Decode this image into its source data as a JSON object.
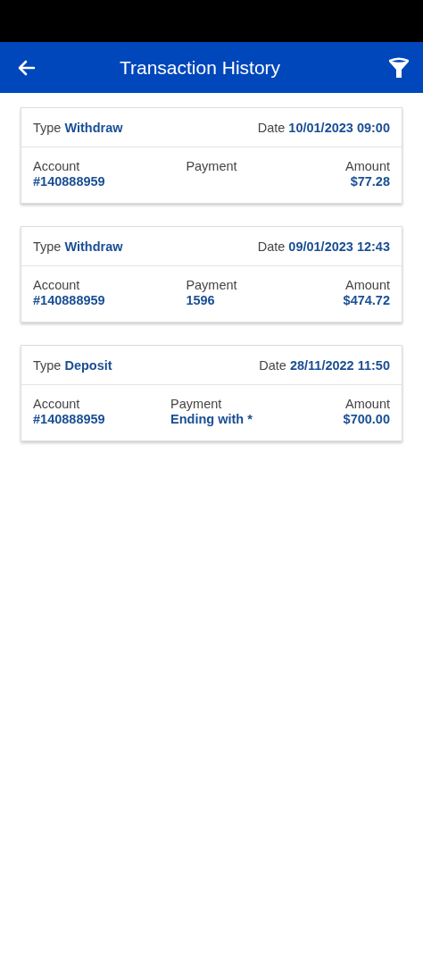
{
  "header": {
    "title": "Transaction History"
  },
  "transactions": [
    {
      "type_label": "Type",
      "type": "Withdraw",
      "date_label": "Date",
      "date": "10/01/2023 09:00",
      "account_label": "Account",
      "account": "#140888959",
      "payment_label": "Payment",
      "amount_label": "Amount",
      "amount": "$77.28"
    },
    {
      "type_label": "Type",
      "type": "Withdraw",
      "date_label": "Date",
      "date": "09/01/2023 12:43",
      "account_label": "Account",
      "account": "#140888959",
      "payment_label": "Payment",
      "payment": "1596",
      "amount_label": "Amount",
      "amount": "$474.72"
    },
    {
      "type_label": "Type",
      "type": "Deposit",
      "date_label": "Date",
      "date": "28/11/2022 11:50",
      "account_label": "Account",
      "account": "#140888959",
      "payment_label": "Payment",
      "payment": "Ending with *",
      "amount_label": "Amount",
      "amount": "$700.00"
    }
  ]
}
